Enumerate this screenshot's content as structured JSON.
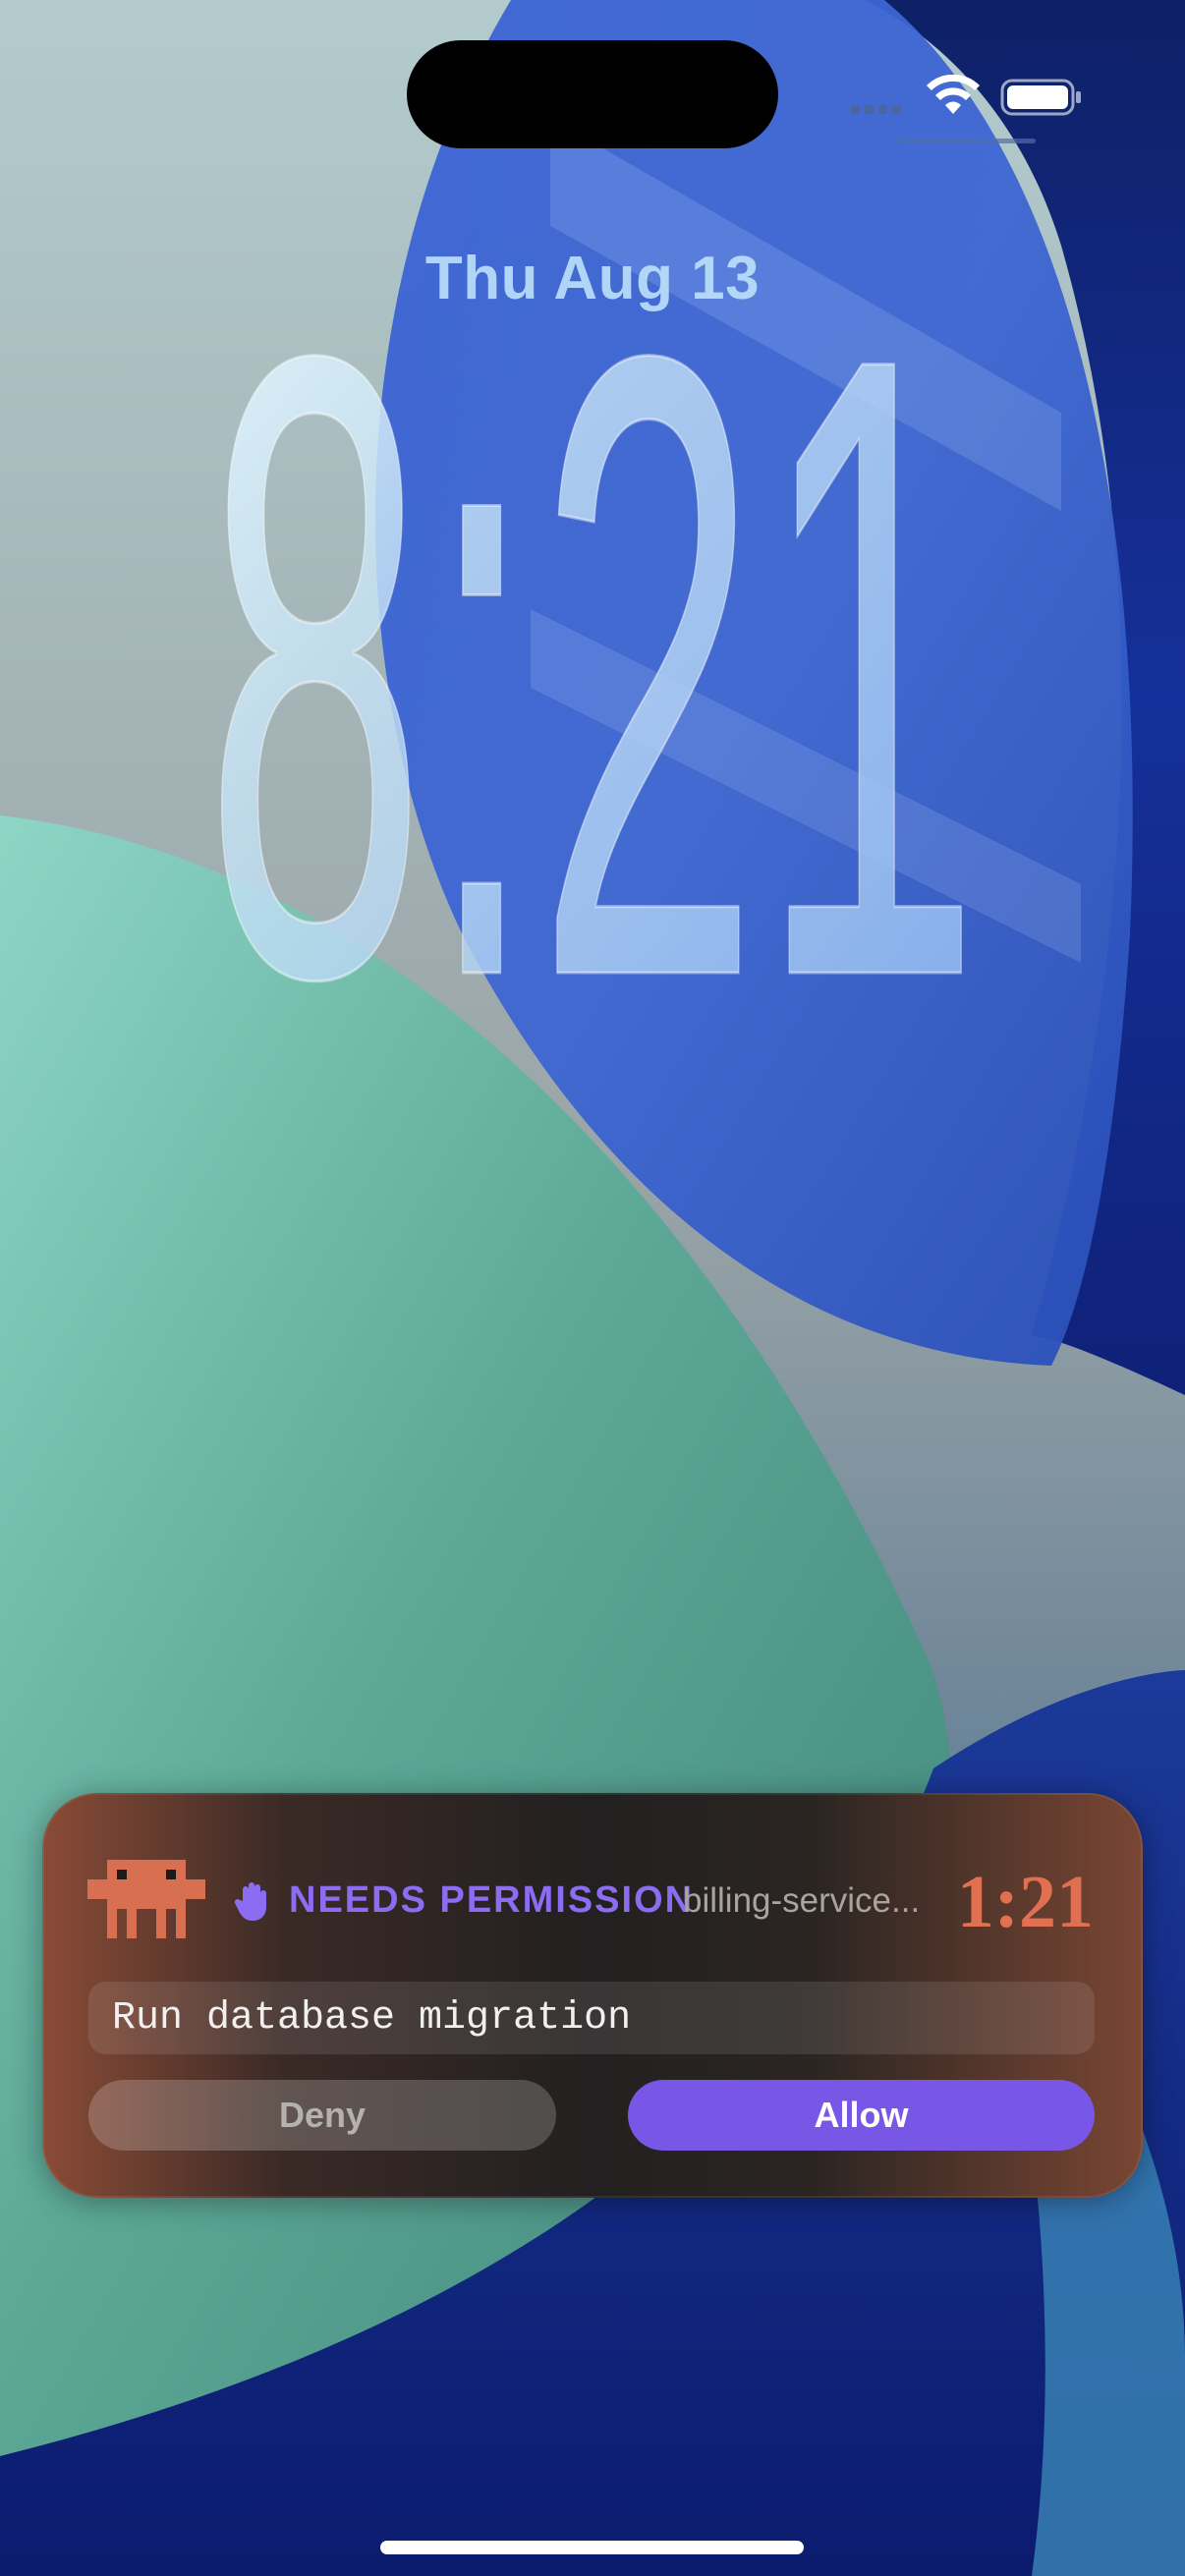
{
  "status_bar": {
    "wifi": "wifi-icon",
    "battery": "battery-icon"
  },
  "lock_screen": {
    "date": "Thu Aug 13",
    "time": "8:21"
  },
  "notification": {
    "app_icon": "pixel-mascot-icon",
    "state_icon": "hand-icon",
    "state_label": "NEEDS PERMISSION",
    "project": "billing-service...",
    "elapsed": "1:21",
    "command": "Run database migration",
    "deny_label": "Deny",
    "allow_label": "Allow",
    "colors": {
      "accent": "#7856e6",
      "state": "#8c6cf0",
      "timer": "#e07050",
      "mascot": "#d86f50"
    }
  }
}
